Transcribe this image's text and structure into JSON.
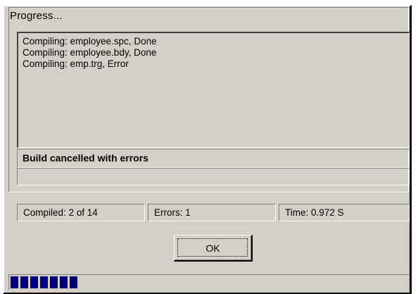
{
  "dialog": {
    "title": "Progress...",
    "log_lines": [
      "Compiling: employee.spc, Done",
      "Compiling: employee.bdy, Done",
      "Compiling: emp.trg, Error"
    ],
    "status": "Build cancelled with errors",
    "status_detail": ""
  },
  "stats": {
    "compiled": "Compiled: 2 of 14",
    "errors": "Errors: 1",
    "time": "Time: 0.972 S"
  },
  "ok_label": "OK",
  "progress": {
    "fraction": 0.175,
    "color": "#000080"
  },
  "colors": {
    "face": "#d4d0c8",
    "shadow": "#808080",
    "highlight": "#ffffff"
  }
}
